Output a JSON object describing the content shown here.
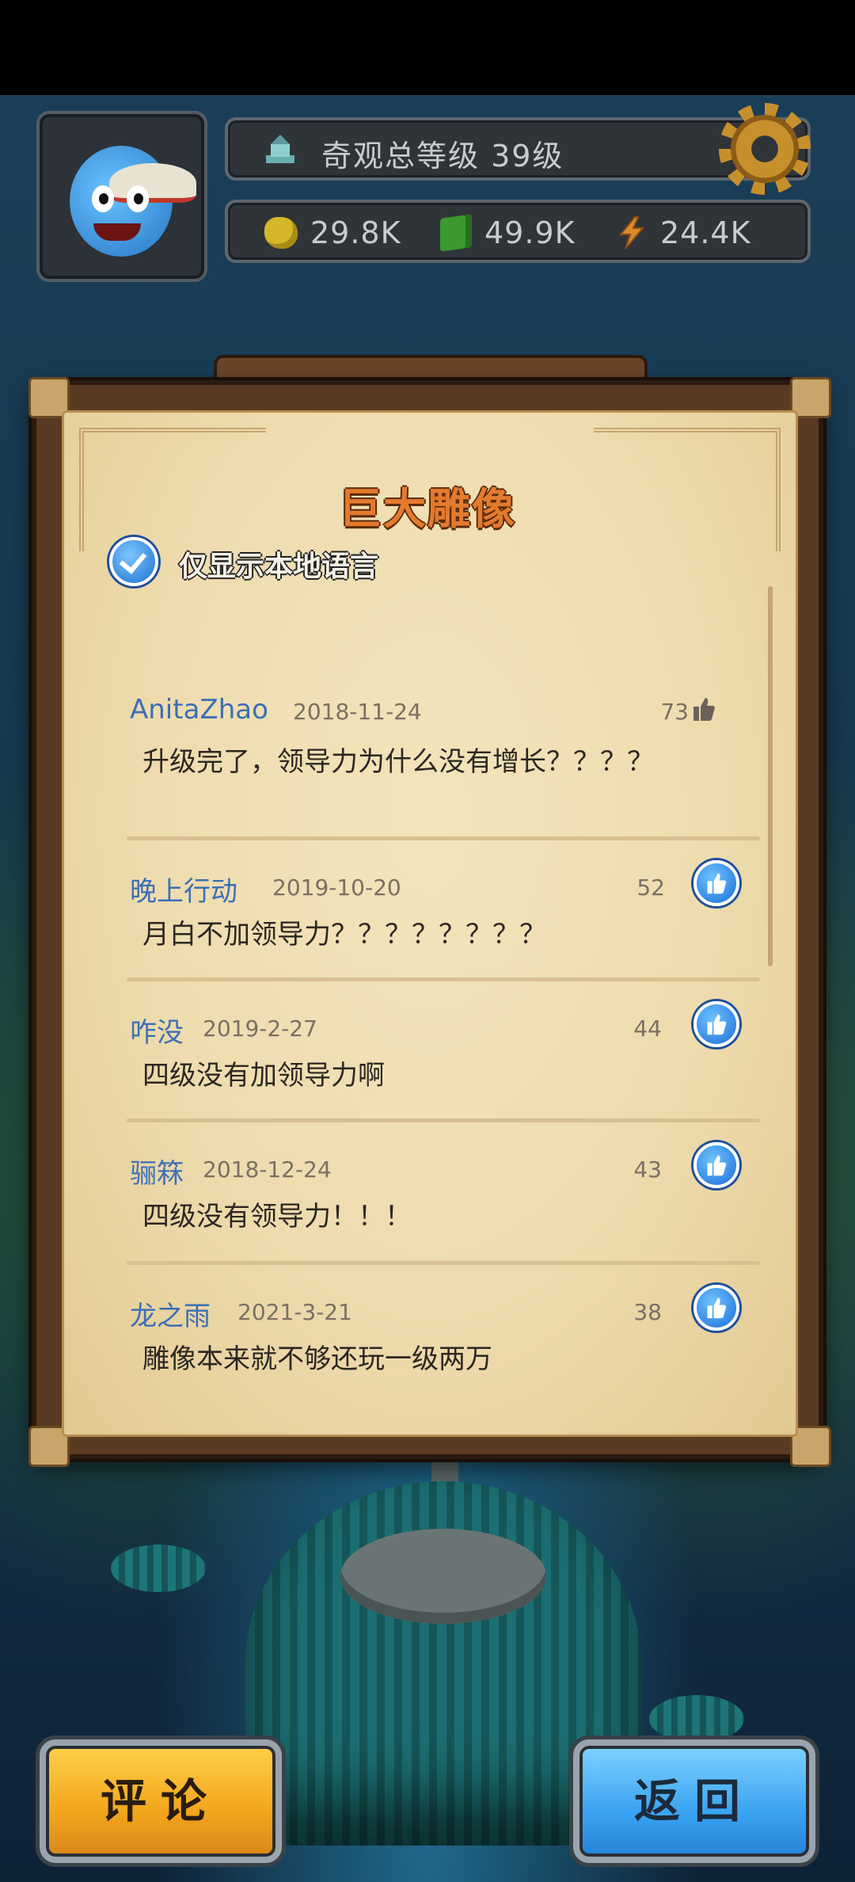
{
  "hud": {
    "wonder_level": "奇观总等级 39级",
    "resources": [
      {
        "icon": "gold-ore-icon",
        "value": "29.8K"
      },
      {
        "icon": "wood-icon",
        "value": "49.9K"
      },
      {
        "icon": "energy-bolt-icon",
        "value": "24.4K"
      }
    ]
  },
  "panel": {
    "title": "巨大雕像",
    "local_only_label": "仅显示本地语言",
    "local_only_checked": true
  },
  "comments": [
    {
      "user": "AnitaZhao",
      "date": "2018-11-24",
      "likes": "73",
      "liked": false,
      "text": "升级完了，领导力为什么没有增长？？？？"
    },
    {
      "user": "晚上行动",
      "date": "2019-10-20",
      "likes": "52",
      "liked": true,
      "text": "月白不加领导力？？？？？？？？"
    },
    {
      "user": "咋没",
      "date": "2019-2-27",
      "likes": "44",
      "liked": true,
      "text": "四级没有加领导力啊"
    },
    {
      "user": "骊箖",
      "date": "2018-12-24",
      "likes": "43",
      "liked": true,
      "text": "四级没有领导力！！！"
    },
    {
      "user": "龙之雨",
      "date": "2021-3-21",
      "likes": "38",
      "liked": true,
      "text": "雕像本来就不够还玩一级两万"
    }
  ],
  "buttons": {
    "comment": "评论",
    "back": "返回"
  },
  "colors": {
    "username": "#3c6fb6",
    "title": "#e47a2e",
    "comment_button": "#f2a51c",
    "back_button": "#3aa3f2"
  }
}
